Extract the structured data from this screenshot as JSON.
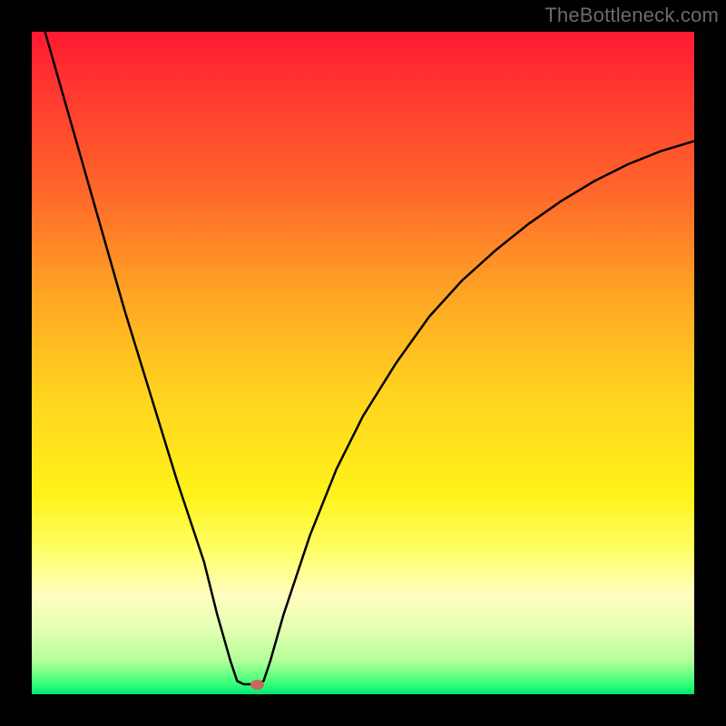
{
  "watermark": {
    "text": "TheBottleneck.com"
  },
  "colors": {
    "frame": "#000000",
    "marker": "#c9685c",
    "curve": "#000000",
    "gradient_stops": [
      {
        "offset": 0.0,
        "color": "#ff1a33"
      },
      {
        "offset": 0.1,
        "color": "#ff3b2f"
      },
      {
        "offset": 0.25,
        "color": "#ff6a2a"
      },
      {
        "offset": 0.4,
        "color": "#ffa624"
      },
      {
        "offset": 0.55,
        "color": "#ffd41e"
      },
      {
        "offset": 0.7,
        "color": "#fff21a"
      },
      {
        "offset": 0.78,
        "color": "#ffff66"
      },
      {
        "offset": 0.85,
        "color": "#fffebf"
      },
      {
        "offset": 0.9,
        "color": "#e6ffb3"
      },
      {
        "offset": 0.95,
        "color": "#b3ff99"
      },
      {
        "offset": 0.985,
        "color": "#33ff77"
      },
      {
        "offset": 1.0,
        "color": "#00e673"
      }
    ]
  },
  "chart_data": {
    "type": "line",
    "title": "",
    "xlabel": "",
    "ylabel": "",
    "xlim": [
      0,
      100
    ],
    "ylim": [
      0,
      100
    ],
    "curve_points": [
      {
        "x": 2.0,
        "y": 100.0
      },
      {
        "x": 6.0,
        "y": 86.0
      },
      {
        "x": 10.0,
        "y": 72.0
      },
      {
        "x": 14.0,
        "y": 58.0
      },
      {
        "x": 18.0,
        "y": 45.0
      },
      {
        "x": 22.0,
        "y": 32.0
      },
      {
        "x": 26.0,
        "y": 20.0
      },
      {
        "x": 28.0,
        "y": 12.0
      },
      {
        "x": 30.0,
        "y": 5.0
      },
      {
        "x": 31.0,
        "y": 2.0
      },
      {
        "x": 32.0,
        "y": 1.5
      },
      {
        "x": 33.0,
        "y": 1.5
      },
      {
        "x": 34.0,
        "y": 1.5
      },
      {
        "x": 35.0,
        "y": 2.0
      },
      {
        "x": 36.0,
        "y": 5.0
      },
      {
        "x": 38.0,
        "y": 12.0
      },
      {
        "x": 42.0,
        "y": 24.0
      },
      {
        "x": 46.0,
        "y": 34.0
      },
      {
        "x": 50.0,
        "y": 42.0
      },
      {
        "x": 55.0,
        "y": 50.0
      },
      {
        "x": 60.0,
        "y": 57.0
      },
      {
        "x": 65.0,
        "y": 62.5
      },
      {
        "x": 70.0,
        "y": 67.0
      },
      {
        "x": 75.0,
        "y": 71.0
      },
      {
        "x": 80.0,
        "y": 74.5
      },
      {
        "x": 85.0,
        "y": 77.5
      },
      {
        "x": 90.0,
        "y": 80.0
      },
      {
        "x": 95.0,
        "y": 82.0
      },
      {
        "x": 100.0,
        "y": 83.5
      }
    ],
    "marker": {
      "x": 34.0,
      "y": 1.5
    }
  }
}
